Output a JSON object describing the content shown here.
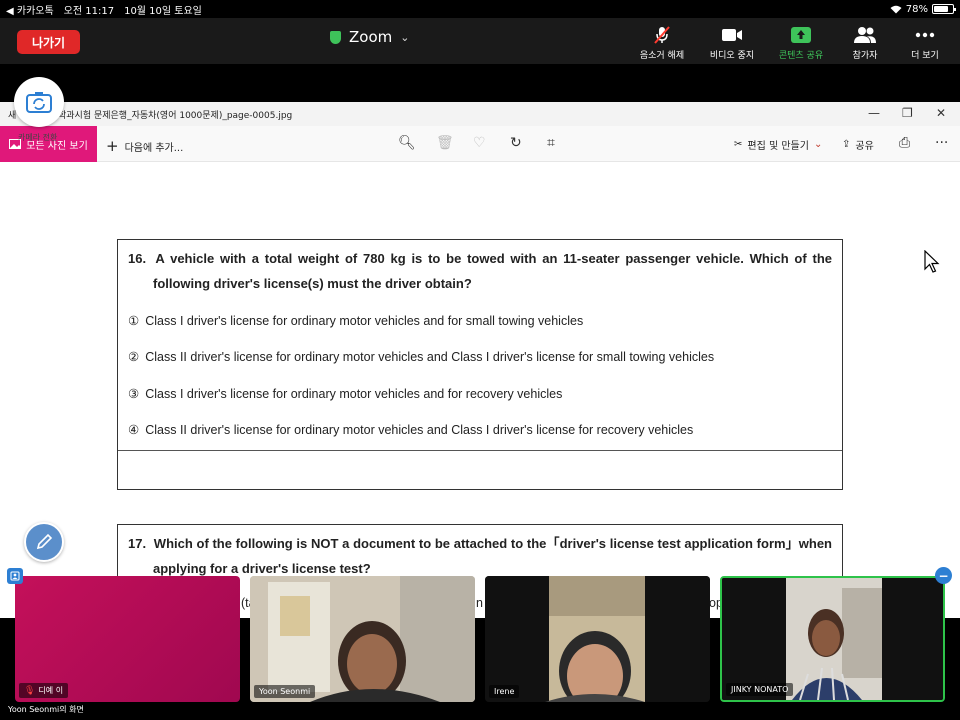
{
  "status_bar": {
    "back_app": "◀ 카카오톡",
    "time": "오전 11:17",
    "date": "10월 10일 토요일",
    "battery": "78%",
    "battery_level": 0.78
  },
  "zoom_bar": {
    "leave_label": "나가기",
    "title": "Zoom",
    "controls": [
      {
        "label": "음소거 해제",
        "icon": "mic-off-icon"
      },
      {
        "label": "비디오 중지",
        "icon": "video-icon"
      },
      {
        "label": "콘텐츠 공유",
        "icon": "share-icon"
      },
      {
        "label": "참가자",
        "icon": "participants-icon"
      },
      {
        "label": "더 보기",
        "icon": "more-icon"
      }
    ]
  },
  "camera_switch_label": "카메라 전환",
  "window": {
    "title": "새            련 외국어 학과시험 문제은행_자동차(영어 1000문제)_page-0005.jpg",
    "all_photos_label": "모든 사진 보기",
    "add_to_label": "다음에 추가...",
    "edit_label": "편집 및 만들기",
    "share_label": "공유"
  },
  "question16": {
    "number": "16.",
    "line1": "A vehicle with a total weight of 780 kg is to be towed with an 11-seater passenger vehicle. Which of the",
    "line2": "following driver's license(s) must the driver obtain?",
    "options": [
      {
        "marker": "①",
        "text": "Class I driver's license for ordinary motor vehicles and for small towing vehicles"
      },
      {
        "marker": "②",
        "text": "Class II driver's license for ordinary motor vehicles and Class I driver's license for small towing vehicles"
      },
      {
        "marker": "③",
        "text": "Class I driver's license for ordinary motor vehicles and for recovery vehicles"
      },
      {
        "marker": "④",
        "text": "Class II driver's license for ordinary motor vehicles and Class I driver's license for recovery vehicles"
      }
    ]
  },
  "question17": {
    "number": "17.",
    "line1": "Which of the following is NOT a document to be attached to the「driver's license test application form」when",
    "line2": "applying for a driver's license test?"
  },
  "peek_text": [
    "(ta",
    "n",
    "op"
  ],
  "participants": [
    {
      "name": "디예 이",
      "mic_off": true
    },
    {
      "name": "Yoon Seonmi",
      "mic_off": false
    },
    {
      "name": "Irene",
      "mic_off": false
    },
    {
      "name": "JINKY NONATO",
      "mic_off": false
    }
  ],
  "screen_owner_label": "Yoon Seonmi의 화면"
}
